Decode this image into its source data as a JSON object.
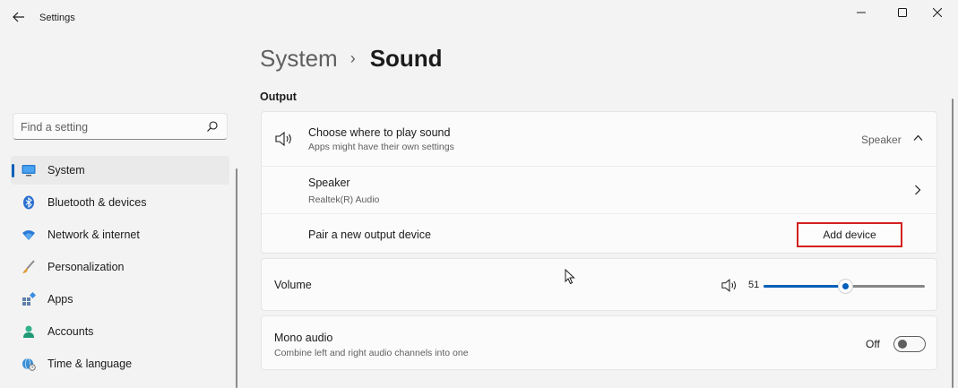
{
  "window": {
    "title": "Settings",
    "minimize_glyph": "—",
    "maximize_glyph": "☐",
    "close_glyph": "✕"
  },
  "search": {
    "placeholder": "Find a setting"
  },
  "sidebar": {
    "items": [
      {
        "label": "System",
        "icon": "system-display-icon",
        "active": true
      },
      {
        "label": "Bluetooth & devices",
        "icon": "bluetooth-icon"
      },
      {
        "label": "Network & internet",
        "icon": "wifi-icon"
      },
      {
        "label": "Personalization",
        "icon": "brush-icon"
      },
      {
        "label": "Apps",
        "icon": "apps-icon"
      },
      {
        "label": "Accounts",
        "icon": "person-icon"
      },
      {
        "label": "Time & language",
        "icon": "globe-clock-icon"
      }
    ]
  },
  "breadcrumb": {
    "parent": "System",
    "separator": "›",
    "current": "Sound"
  },
  "output": {
    "section_title": "Output",
    "choose": {
      "title": "Choose where to play sound",
      "subtitle": "Apps might have their own settings",
      "value": "Speaker"
    },
    "speaker": {
      "title": "Speaker",
      "subtitle": "Realtek(R) Audio"
    },
    "pair": {
      "title": "Pair a new output device",
      "button_label": "Add device"
    },
    "volume": {
      "title": "Volume",
      "value": "51",
      "level": 0.51
    },
    "mono": {
      "title": "Mono audio",
      "subtitle": "Combine left and right audio channels into one",
      "state_label": "Off"
    }
  },
  "colors": {
    "accent": "#005fb8",
    "highlight_border": "#d42020"
  }
}
